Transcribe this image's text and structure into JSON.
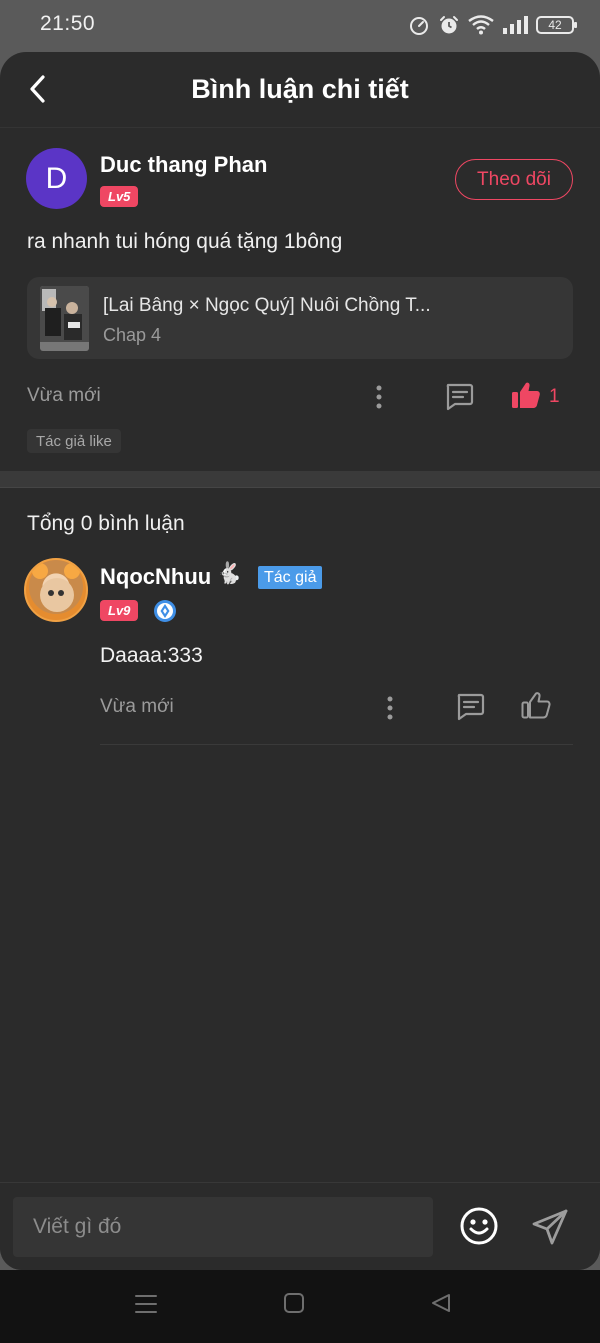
{
  "status_bar": {
    "time": "21:50",
    "battery": "42"
  },
  "header": {
    "title": "Bình luận chi tiết"
  },
  "comment": {
    "avatar_letter": "D",
    "user_name": "Duc thang Phan",
    "level": "Lv5",
    "follow_label": "Theo dõi",
    "text": "ra nhanh tui hóng quá tặng 1bông",
    "chapter": {
      "title": "[Lai Bâng × Ngọc Quý] Nuôi Chồng T...",
      "subtitle": "Chap 4"
    },
    "time": "Vừa mới",
    "like_count": "1",
    "author_like_tag": "Tác giả like"
  },
  "replies_section": {
    "total_label": "Tổng 0 bình luận",
    "replies": [
      {
        "user_name": "NqocNhuu",
        "emoji": "🐇",
        "author_tag": "Tác giả",
        "level": "Lv9",
        "text": "Daaaa:333",
        "time": "Vừa mới"
      }
    ]
  },
  "input": {
    "placeholder": "Viết gì đó"
  },
  "colors": {
    "accent": "#ef4763",
    "background": "#2b2b2b",
    "author_tag": "#4b9be9",
    "avatar": "#5b35c6"
  }
}
